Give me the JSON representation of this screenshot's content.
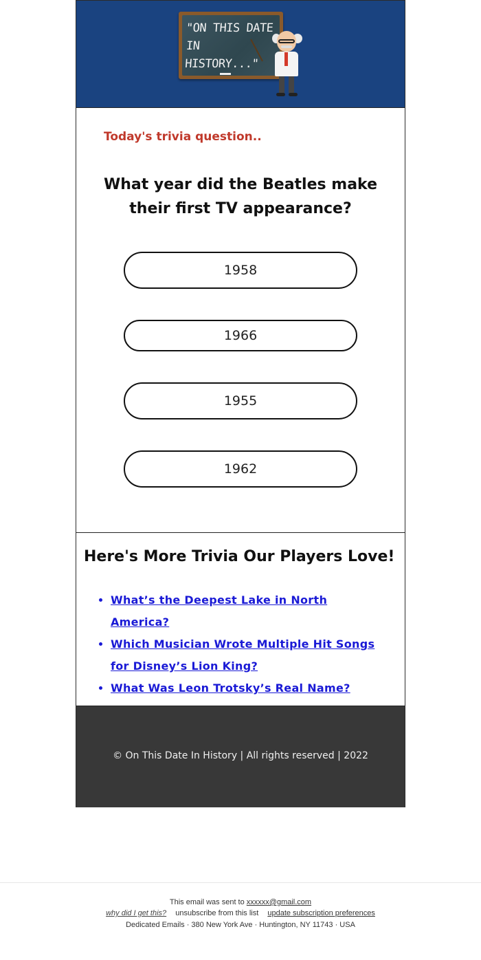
{
  "header": {
    "board_line1": "\"ON THIS DATE",
    "board_line2": "IN HISTORY...\"",
    "brand_color": "#1a4380"
  },
  "question_section": {
    "eyebrow": "Today's trivia question..",
    "question": "What year did the Beatles make their first TV appearance?",
    "answers": [
      "1958",
      "1966",
      "1955",
      "1962"
    ]
  },
  "more_trivia": {
    "title": "Here's More Trivia Our Players Love!",
    "links": [
      "What’s the Deepest Lake in North America?",
      "Which Musician Wrote Multiple Hit Songs for Disney’s Lion King?",
      "What Was Leon Trotsky’s Real Name?"
    ]
  },
  "footer": {
    "copyright": "© On This Date In History | All rights reserved | 2022"
  },
  "system_footer": {
    "sent_to_prefix": "This email was sent to",
    "email": "xxxxxx@gmail.com",
    "why_link": "why did I get this?",
    "unsubscribe": "unsubscribe from this list",
    "update_prefs": "update subscription preferences",
    "address": "Dedicated Emails · 380 New York Ave · Huntington, NY 11743 · USA"
  }
}
